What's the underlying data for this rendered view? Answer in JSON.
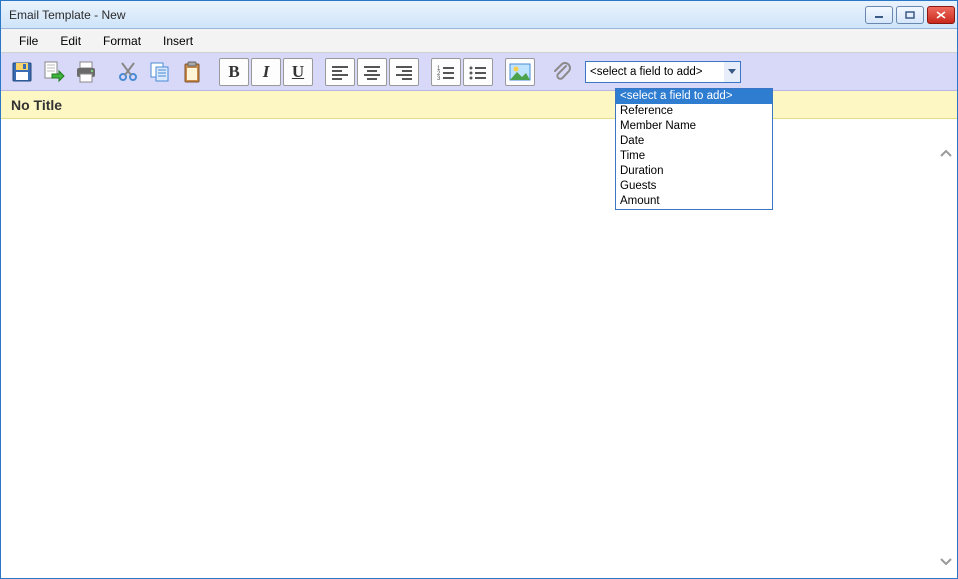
{
  "window": {
    "title": "Email Template - New"
  },
  "menubar": {
    "items": [
      "File",
      "Edit",
      "Format",
      "Insert"
    ]
  },
  "toolbar": {
    "bold": "B",
    "italic": "I",
    "underline": "U",
    "field_select_text": "<select a field to add>"
  },
  "dropdown": {
    "options": [
      "<select a field to add>",
      "Reference",
      "Member Name",
      "Date",
      "Time",
      "Duration",
      "Guests",
      "Amount"
    ]
  },
  "subject": {
    "text": "No Title"
  }
}
